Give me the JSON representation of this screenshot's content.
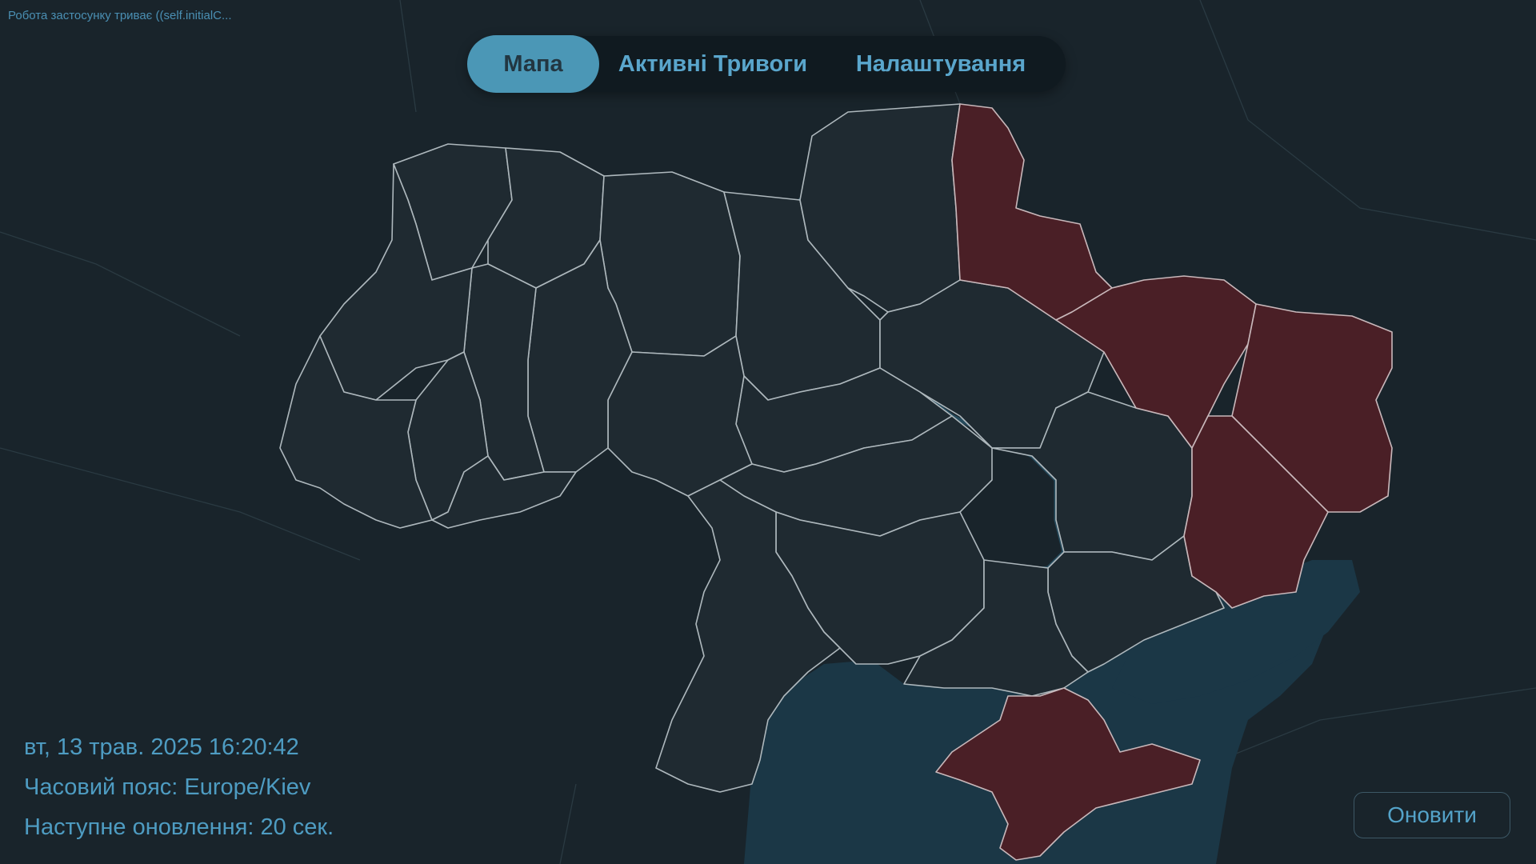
{
  "status_bar": {
    "text": "Робота застосунку триває ((self.initialC..."
  },
  "tabs": [
    {
      "label": "Мапа",
      "active": true
    },
    {
      "label": "Активні Тривоги",
      "active": false
    },
    {
      "label": "Налаштування",
      "active": false
    }
  ],
  "info": {
    "datetime": "вт, 13 трав. 2025 16:20:42",
    "timezone": "Часовий пояс: Europe/Kiev",
    "next_update": "Наступне оновлення: 20 сек."
  },
  "refresh_button": {
    "label": "Оновити"
  },
  "map": {
    "alert_regions": [
      "Sumy",
      "Kharkiv",
      "Luhansk",
      "Donetsk",
      "Crimea"
    ],
    "colors": {
      "background": "#19242b",
      "region_fill": "#1f2a31",
      "alert_fill": "#4a1f26",
      "sea": "#1b3746",
      "accent": "#4b97b6"
    }
  }
}
